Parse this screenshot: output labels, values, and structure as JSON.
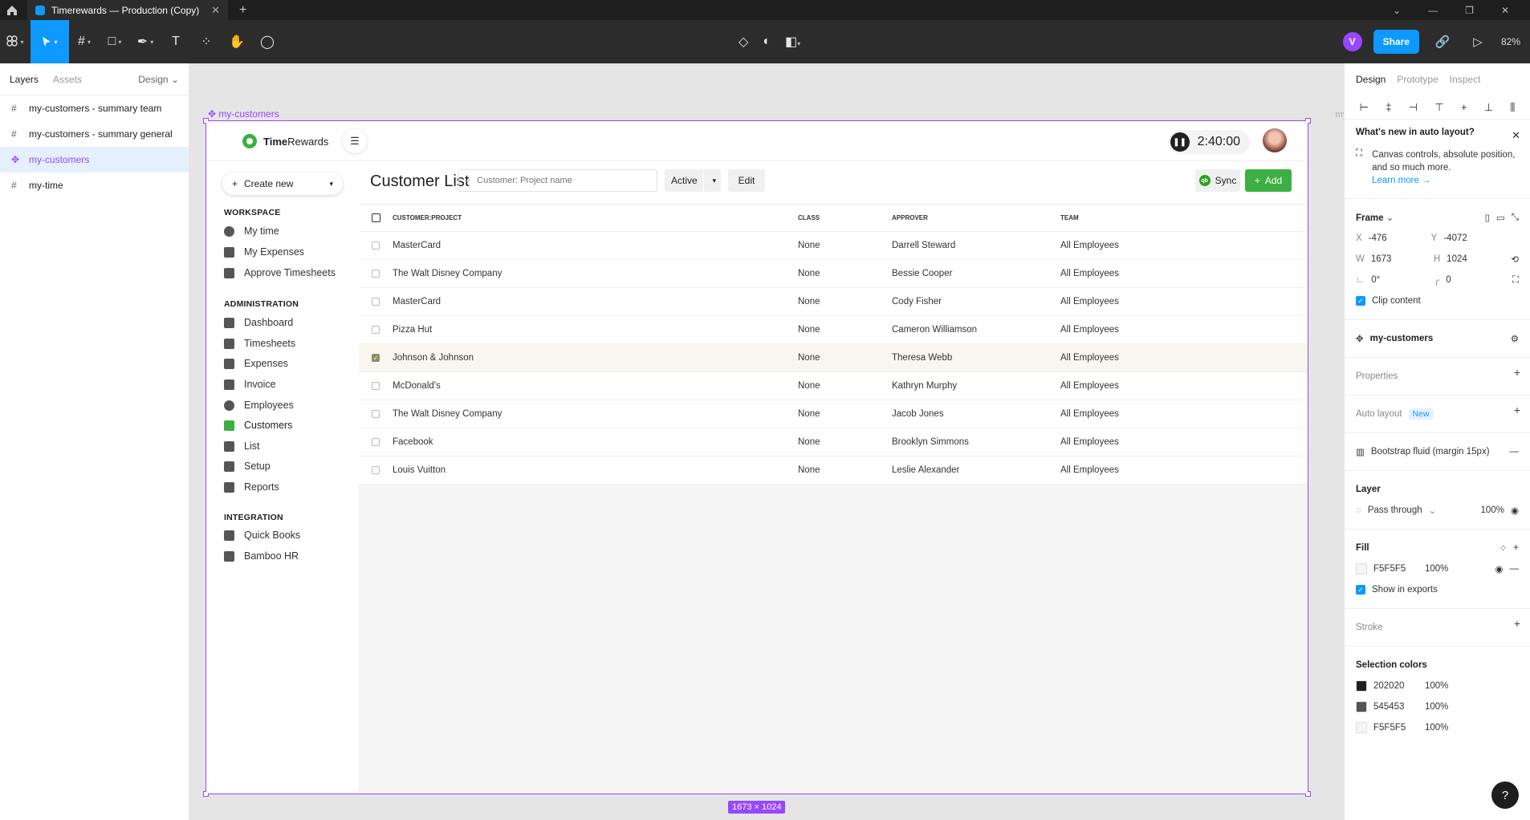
{
  "window": {
    "tab_title": "Timerewards — Production (Copy)",
    "new_tab": "+"
  },
  "toolbar": {
    "share_label": "Share",
    "user_initial": "V",
    "zoom": "82%"
  },
  "layers_panel": {
    "tabs": [
      "Layers",
      "Assets"
    ],
    "page_selector": "Design",
    "layers": [
      {
        "name": "my-customers - summary team",
        "selected": false
      },
      {
        "name": "my-customers - summary general",
        "selected": false
      },
      {
        "name": "my-customers",
        "selected": true
      },
      {
        "name": "my-time",
        "selected": false
      }
    ]
  },
  "canvas": {
    "frame_label": "my-customers",
    "frame_label_clipped": "my-",
    "size_badge": "1673 × 1024"
  },
  "app": {
    "brand_bold": "Time",
    "brand_rest": "Rewards",
    "timer": "2:40:00",
    "create_new": "Create new",
    "sections": {
      "workspace": "WORKSPACE",
      "administration": "ADMINISTRATION",
      "integration": "INTEGRATION"
    },
    "workspace_items": [
      "My time",
      "My Expenses",
      "Approve Timesheets"
    ],
    "admin_items": [
      "Dashboard",
      "Timesheets",
      "Expenses",
      "Invoice",
      "Employees",
      "Customers",
      "List",
      "Setup",
      "Reports"
    ],
    "integration_items": [
      "Quick Books",
      "Bamboo HR"
    ],
    "page_title": "Customer List",
    "search_placeholder": "Customer: Project name",
    "status_value": "Active",
    "edit_label": "Edit",
    "sync_label": "Sync",
    "qb_icon_text": "qb",
    "add_label": "Add",
    "columns": [
      "CUSTOMER:PROJECT",
      "CLASS",
      "APPROVER",
      "TEAM"
    ],
    "rows": [
      {
        "name": "MasterCard",
        "class": "None",
        "approver": "Darrell Steward",
        "team": "All Employees",
        "checked": false
      },
      {
        "name": "The Walt Disney Company",
        "class": "None",
        "approver": "Bessie Cooper",
        "team": "All Employees",
        "checked": false
      },
      {
        "name": "MasterCard",
        "class": "None",
        "approver": "Cody Fisher",
        "team": "All Employees",
        "checked": false
      },
      {
        "name": "Pizza Hut",
        "class": "None",
        "approver": "Cameron Williamson",
        "team": "All Employees",
        "checked": false
      },
      {
        "name": "Johnson & Johnson",
        "class": "None",
        "approver": "Theresa Webb",
        "team": "All Employees",
        "checked": true
      },
      {
        "name": "McDonald's",
        "class": "None",
        "approver": "Kathryn Murphy",
        "team": "All Employees",
        "checked": false
      },
      {
        "name": "The Walt Disney Company",
        "class": "None",
        "approver": "Jacob Jones",
        "team": "All Employees",
        "checked": false
      },
      {
        "name": "Facebook",
        "class": "None",
        "approver": "Brooklyn Simmons",
        "team": "All Employees",
        "checked": false
      },
      {
        "name": "Louis Vuitton",
        "class": "None",
        "approver": "Leslie Alexander",
        "team": "All Employees",
        "checked": false
      }
    ]
  },
  "design_panel": {
    "tabs": [
      "Design",
      "Prototype",
      "Inspect"
    ],
    "whats_new_title": "What's new in auto layout?",
    "whats_new_body": "Canvas controls, absolute position, and so much more.",
    "learn_more": "Learn more →",
    "frame_label": "Frame",
    "x_label": "X",
    "x_value": "-476",
    "y_label": "Y",
    "y_value": "-4072",
    "w_label": "W",
    "w_value": "1673",
    "h_label": "H",
    "h_value": "1024",
    "rotation": "0°",
    "radius": "0",
    "clip_content": "Clip content",
    "component_name": "my-customers",
    "properties": "Properties",
    "auto_layout": "Auto layout",
    "new_badge": "New",
    "grid_label": "Bootstrap fluid (margin 15px)",
    "layer_title": "Layer",
    "blend_mode": "Pass through",
    "layer_opacity": "100%",
    "fill_title": "Fill",
    "fill_hex": "F5F5F5",
    "fill_opacity": "100%",
    "show_in_exports": "Show in exports",
    "stroke_title": "Stroke",
    "selection_colors_title": "Selection colors",
    "selection_colors": [
      {
        "hex": "202020",
        "opacity": "100%",
        "color": "#202020"
      },
      {
        "hex": "545453",
        "opacity": "100%",
        "color": "#545453"
      },
      {
        "hex": "F5F5F5",
        "opacity": "100%",
        "color": "#F5F5F5"
      }
    ],
    "help": "?"
  },
  "colors": {
    "accent": "#0d99ff",
    "selection": "#9747ff",
    "brand_green": "#3cb043"
  }
}
